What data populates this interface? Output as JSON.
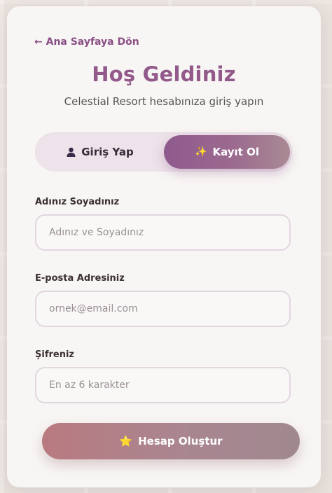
{
  "back_link": {
    "label": "← Ana Sayfaya Dön"
  },
  "header": {
    "title": "Hoş Geldiniz",
    "subtitle": "Celestial Resort hesabınıza giriş yapın"
  },
  "tabs": [
    {
      "label": "Giriş Yap",
      "icon": "user-icon",
      "active": false
    },
    {
      "label": "Kayıt Ol",
      "icon": "sparkles-icon",
      "icon_glyph": "✨",
      "active": true
    }
  ],
  "form": {
    "name": {
      "label": "Adınız Soyadınız",
      "placeholder": "Adınız ve Soyadınız",
      "value": ""
    },
    "email": {
      "label": "E-posta Adresiniz",
      "placeholder": "ornek@email.com",
      "value": ""
    },
    "password": {
      "label": "Şifreniz",
      "placeholder": "En az 6 karakter",
      "value": ""
    },
    "submit": {
      "label": "Hesap Oluştur",
      "icon": "star-icon",
      "icon_glyph": "⭐"
    }
  },
  "colors": {
    "accent": "#92598a",
    "tab_active_start": "#8e5a8e",
    "tab_active_end": "#a98a93",
    "submit_start": "#b97a80",
    "submit_end": "#a0888f",
    "card_bg": "#f8f6f4"
  }
}
